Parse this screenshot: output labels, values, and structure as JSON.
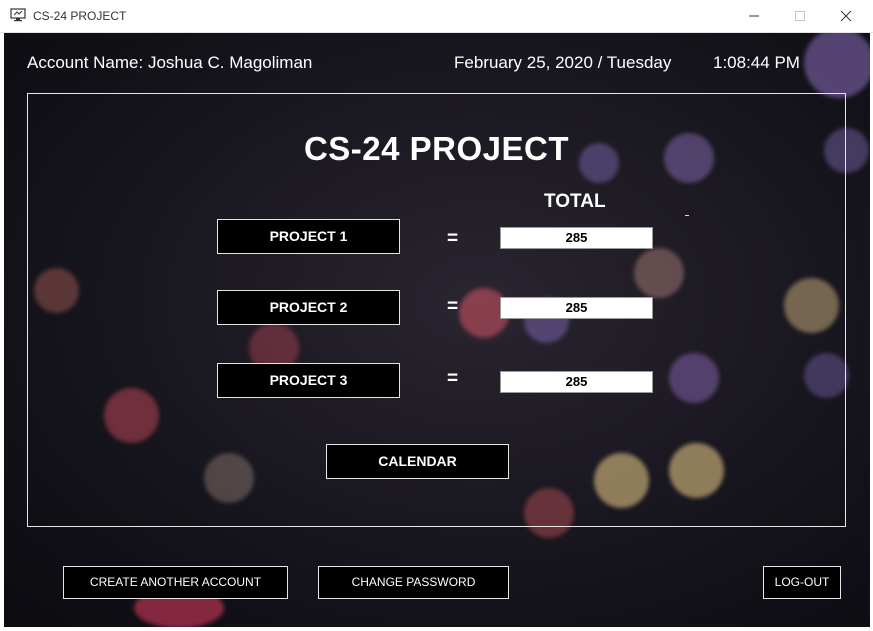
{
  "window": {
    "title": "CS-24 PROJECT",
    "icons": [
      "app-monitor-icon",
      "minimize-icon",
      "maximize-icon",
      "close-icon"
    ]
  },
  "header": {
    "account_label": "Account Name: Joshua C. Magoliman",
    "date": "February 25, 2020 / Tuesday",
    "time": "1:08:44 PM"
  },
  "panel": {
    "title": "CS-24 PROJECT",
    "total_label": "TOTAL",
    "projects": [
      {
        "label": "PROJECT 1",
        "equals": "=",
        "total": "285"
      },
      {
        "label": "PROJECT 2",
        "equals": "=",
        "total": "285"
      },
      {
        "label": "PROJECT 3",
        "equals": "=",
        "total": "285"
      }
    ],
    "calendar_label": "CALENDAR"
  },
  "footer": {
    "create_account_label": "CREATE ANOTHER ACCOUNT",
    "change_password_label": "CHANGE PASSWORD",
    "logout_label": "LOG-OUT"
  },
  "colors": {
    "background": "#17151d",
    "button_bg": "#000000",
    "button_border": "#e6e6e6",
    "text": "#ffffff"
  }
}
